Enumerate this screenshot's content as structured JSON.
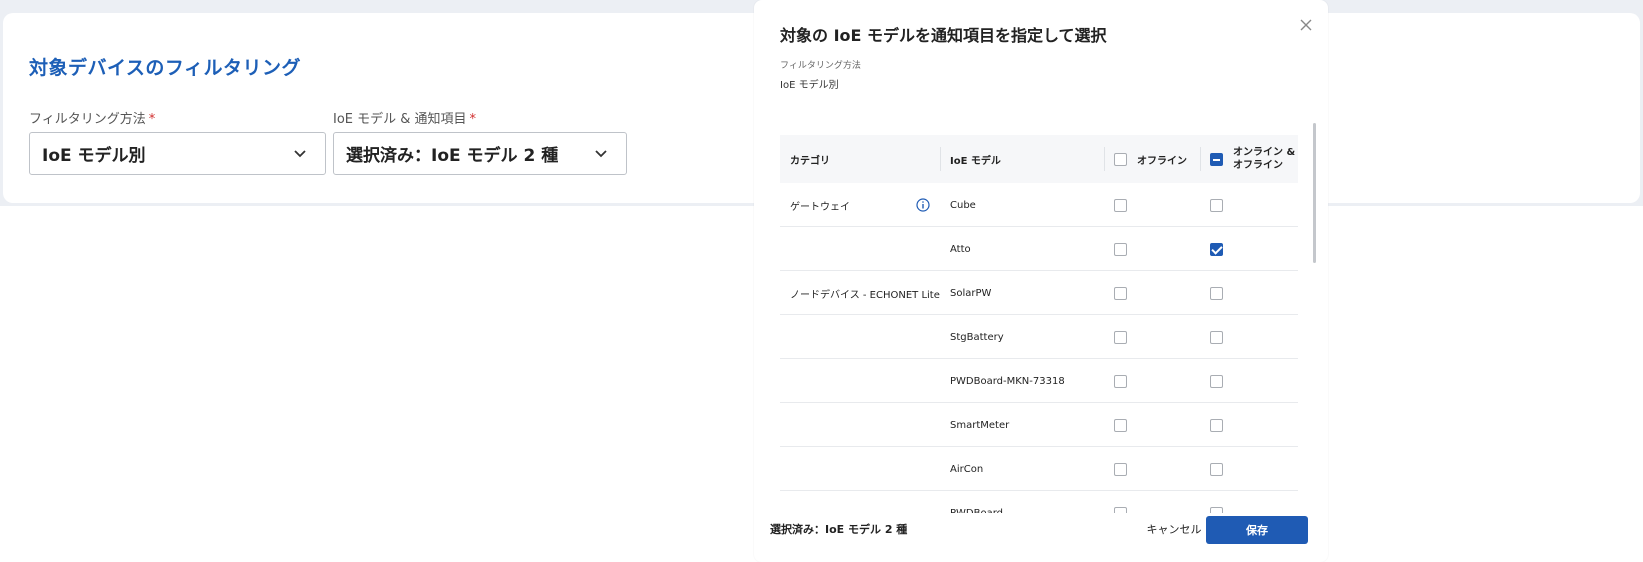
{
  "filter_card": {
    "title": "対象デバイスのフィルタリング",
    "method": {
      "label": "フィルタリング方法",
      "required_mark": "*",
      "value": "IoE モデル別"
    },
    "models": {
      "label": "IoE モデル & 通知項目",
      "required_mark": "*",
      "value": "選択済み：IoE モデル 2 種"
    }
  },
  "modal": {
    "title": "対象の IoE モデルを通知項目を指定して選択",
    "filter_method_label": "フィルタリング方法",
    "filter_method_value": "IoE モデル別",
    "table": {
      "headers": {
        "category": "カテゴリ",
        "model": "IoE モデル",
        "offline": "オフライン",
        "online_offline_line1": "オンライン &",
        "online_offline_line2": "オフライン"
      },
      "rows": [
        {
          "category": "ゲートウェイ",
          "model": "Cube",
          "offline": false,
          "online_offline": false
        },
        {
          "category": "",
          "model": "Atto",
          "offline": false,
          "online_offline": true
        },
        {
          "category": "ノードデバイス - ECHONET Lite",
          "model": "SolarPW",
          "offline": false,
          "online_offline": false
        },
        {
          "category": "",
          "model": "StgBattery",
          "offline": false,
          "online_offline": false
        },
        {
          "category": "",
          "model": "PWDBoard-MKN-73318",
          "offline": false,
          "online_offline": false
        },
        {
          "category": "",
          "model": "SmartMeter",
          "offline": false,
          "online_offline": false
        },
        {
          "category": "",
          "model": "AirCon",
          "offline": false,
          "online_offline": false
        },
        {
          "category": "",
          "model": "PWDBoard",
          "offline": false,
          "online_offline": false
        }
      ]
    },
    "footer": {
      "selected": "選択済み：IoE モデル 2 種",
      "cancel": "キャンセル",
      "save": "保存"
    }
  },
  "colors": {
    "accent": "#1f5bb4",
    "title_blue": "#1d5fb7",
    "required": "#d12f2f"
  },
  "icons": {
    "close": "close-icon",
    "chevron": "chevron-down-icon",
    "info": "info-icon"
  }
}
